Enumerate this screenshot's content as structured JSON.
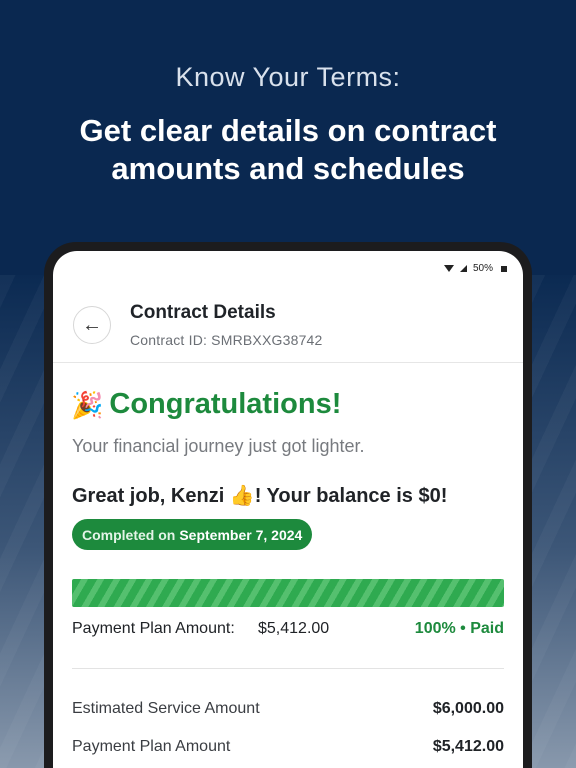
{
  "promo": {
    "eyebrow": "Know Your Terms:",
    "title_line1": "Get clear details on contract",
    "title_line2": "amounts and schedules"
  },
  "status_bar": {
    "battery": "50%"
  },
  "header": {
    "title": "Contract Details",
    "contract_id": "Contract ID: SMRBXXG38742",
    "back_icon": "←"
  },
  "main": {
    "party_icon": "🎉",
    "congrats": "Congratulations!",
    "tagline": "Your financial journey just got lighter.",
    "greeting": "Great job, Kenzi 👍! Your balance is $0!",
    "badge_prefix": "Completed on",
    "badge_date": "September 7, 2024",
    "progress_percent": 100,
    "plan_label": "Payment Plan Amount:",
    "plan_value": "$5,412.00",
    "paid_status": "100% • Paid",
    "details": [
      {
        "label": "Estimated Service Amount",
        "value": "$6,000.00"
      },
      {
        "label": "Payment Plan Amount",
        "value": "$5,412.00"
      }
    ]
  },
  "colors": {
    "background": "#0a2850",
    "success_green": "#1d8a3d",
    "progress_green": "#2faa50"
  }
}
